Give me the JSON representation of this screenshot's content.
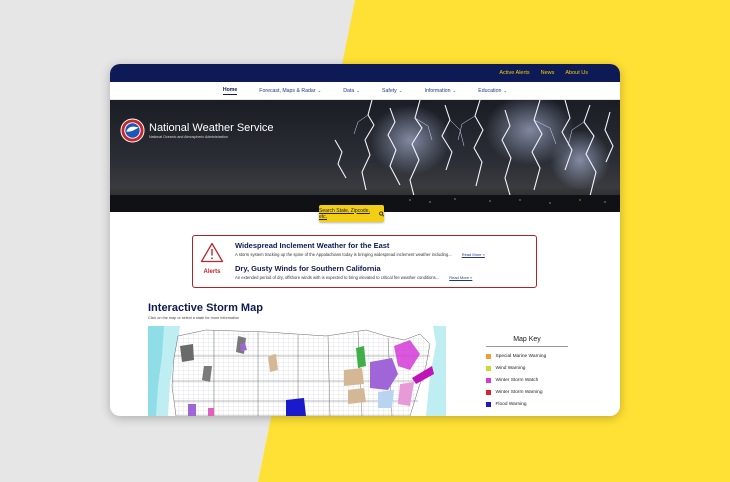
{
  "topbar": {
    "links": [
      "Active Alerts",
      "News",
      "About Us"
    ]
  },
  "nav": {
    "home": "Home",
    "forecast": "Forecast, Maps & Radar",
    "data": "Data",
    "safety": "Safety",
    "information": "Information",
    "education": "Education"
  },
  "brand": {
    "name": "National Weather Service",
    "subtitle": "National Oceanic and Atmospheric Administration"
  },
  "search": {
    "placeholder": "Search State, Zipcode, etc."
  },
  "alerts": {
    "label": "Alerts",
    "items": [
      {
        "title": "Widespread Inclement Weather for the East",
        "text": "A storm system tracking up the spine of the Appalachians today is bringing widespread inclement weather including...",
        "link": "Read More »"
      },
      {
        "title": "Dry, Gusty Winds for Southern California",
        "text": "An extended period of dry, offshore winds with is expected to bring elevated to critical fire weather conditions...",
        "link": "Read More »"
      }
    ]
  },
  "map": {
    "title": "Interactive Storm Map",
    "subtitle": "Click on the map or select a state for more information"
  },
  "key": {
    "title": "Map Key",
    "items": [
      {
        "label": "Special Marine Warning",
        "color": "#f0a030"
      },
      {
        "label": "Wind Warning",
        "color": "#c8dc30"
      },
      {
        "label": "Winter Storm Watch",
        "color": "#d33ad8"
      },
      {
        "label": "Winter Storm Warning",
        "color": "#e02020"
      },
      {
        "label": "Flood Warning",
        "color": "#1a1acc"
      }
    ]
  },
  "colors": {
    "brand_navy": "#0d1a55",
    "accent_yellow": "#f2cf14",
    "alert_red": "#b22222",
    "background_yellow": "#ffe135"
  }
}
